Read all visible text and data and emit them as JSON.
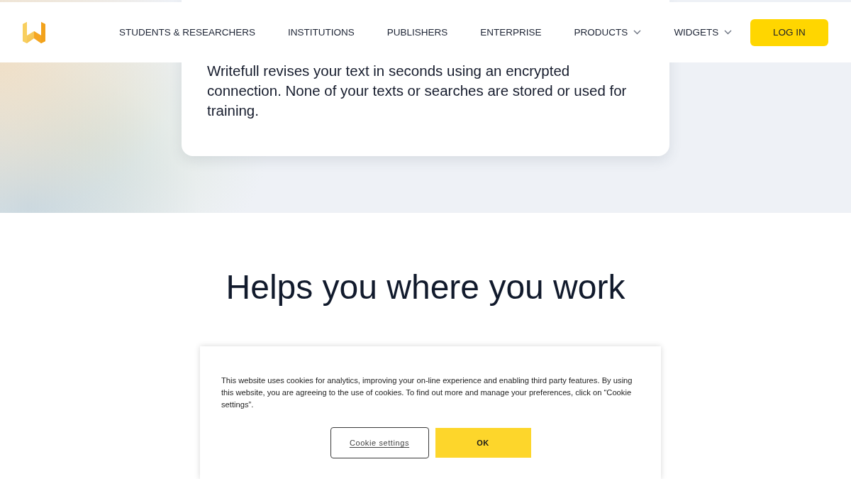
{
  "header": {
    "nav": [
      {
        "label": "STUDENTS & RESEARCHERS",
        "dropdown": false
      },
      {
        "label": "INSTITUTIONS",
        "dropdown": false
      },
      {
        "label": "PUBLISHERS",
        "dropdown": false
      },
      {
        "label": "ENTERPRISE",
        "dropdown": false
      },
      {
        "label": "PRODUCTS",
        "dropdown": true
      },
      {
        "label": "WIDGETS",
        "dropdown": true
      }
    ],
    "login_button": "LOG IN"
  },
  "hero": {
    "card_text": "Writefull revises your text in seconds using an encrypted connection. None of your texts or searches are stored or used for training."
  },
  "section": {
    "heading": "Helps you where you work"
  },
  "cookie_banner": {
    "text": "This website uses cookies for analytics, improving your on-line experience and enabling third party features. By using this website, you are agreeing to the use of cookies. To find out more and manage your preferences, click on “Cookie settings”.",
    "buttons": [
      {
        "label": "Cookie settings",
        "kind": "outline"
      },
      {
        "label": "OK",
        "kind": "primary"
      }
    ]
  }
}
